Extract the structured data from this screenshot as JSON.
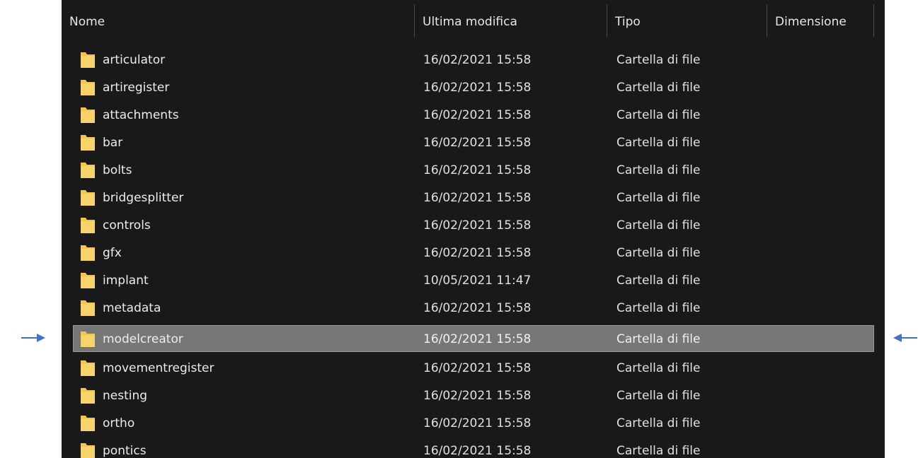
{
  "columns": {
    "name": "Nome",
    "modified": "Ultima modifica",
    "type": "Tipo",
    "size": "Dimensione"
  },
  "sort_indicator_icon": "chevron-up-icon",
  "rows": [
    {
      "name": "articulator",
      "modified": "16/02/2021 15:58",
      "type": "Cartella di file",
      "selected": false
    },
    {
      "name": "artiregister",
      "modified": "16/02/2021 15:58",
      "type": "Cartella di file",
      "selected": false
    },
    {
      "name": "attachments",
      "modified": "16/02/2021 15:58",
      "type": "Cartella di file",
      "selected": false
    },
    {
      "name": "bar",
      "modified": "16/02/2021 15:58",
      "type": "Cartella di file",
      "selected": false
    },
    {
      "name": "bolts",
      "modified": "16/02/2021 15:58",
      "type": "Cartella di file",
      "selected": false
    },
    {
      "name": "bridgesplitter",
      "modified": "16/02/2021 15:58",
      "type": "Cartella di file",
      "selected": false
    },
    {
      "name": "controls",
      "modified": "16/02/2021 15:58",
      "type": "Cartella di file",
      "selected": false
    },
    {
      "name": "gfx",
      "modified": "16/02/2021 15:58",
      "type": "Cartella di file",
      "selected": false
    },
    {
      "name": "implant",
      "modified": "10/05/2021 11:47",
      "type": "Cartella di file",
      "selected": false
    },
    {
      "name": "metadata",
      "modified": "16/02/2021 15:58",
      "type": "Cartella di file",
      "selected": false
    },
    {
      "name": "modelcreator",
      "modified": "16/02/2021 15:58",
      "type": "Cartella di file",
      "selected": true
    },
    {
      "name": "movementregister",
      "modified": "16/02/2021 15:58",
      "type": "Cartella di file",
      "selected": false
    },
    {
      "name": "nesting",
      "modified": "16/02/2021 15:58",
      "type": "Cartella di file",
      "selected": false
    },
    {
      "name": "ortho",
      "modified": "16/02/2021 15:58",
      "type": "Cartella di file",
      "selected": false
    },
    {
      "name": "pontics",
      "modified": "16/02/2021 15:58",
      "type": "Cartella di file",
      "selected": false
    }
  ],
  "colors": {
    "background": "#191919",
    "selected_row": "#777777",
    "folder": "#f5c54e",
    "annotation_arrow": "#4472c4"
  },
  "annotations": {
    "left_arrow_icon": "arrow-right-icon",
    "right_arrow_icon": "arrow-left-icon"
  }
}
